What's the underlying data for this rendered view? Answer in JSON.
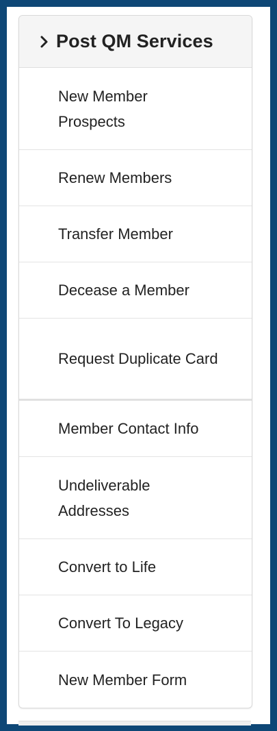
{
  "panel": {
    "title": "Post QM Services",
    "items": [
      {
        "label": "New Member Prospects"
      },
      {
        "label": "Renew Members"
      },
      {
        "label": "Transfer Member"
      },
      {
        "label": "Decease a Member"
      },
      {
        "label": "Request Duplicate Card"
      },
      {
        "label": "Member Contact Info"
      },
      {
        "label": "Undeliverable Addresses"
      },
      {
        "label": "Convert to Life"
      },
      {
        "label": "Convert To Legacy"
      },
      {
        "label": "New Member Form"
      }
    ]
  },
  "icons": {
    "header": "chevron-right-icon"
  },
  "colors": {
    "frame": "#0e4776",
    "header_bg": "#f5f5f5",
    "text": "#222222"
  }
}
